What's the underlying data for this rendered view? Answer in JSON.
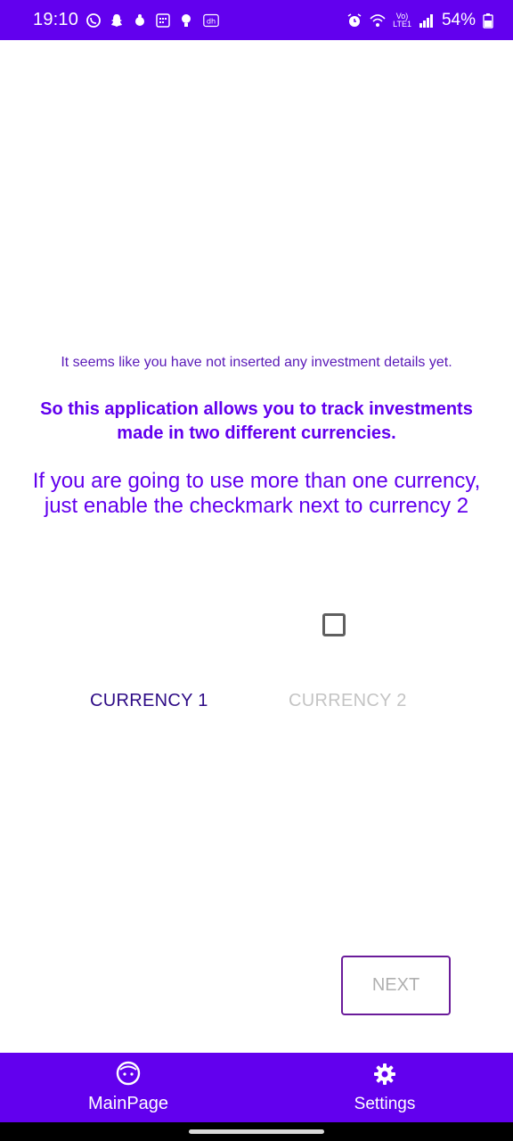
{
  "status_bar": {
    "time": "19:10",
    "left_icons": [
      "whatsapp-icon",
      "snapchat-icon",
      "notification-icon",
      "calendar-icon",
      "bulb-icon",
      "dh-icon"
    ],
    "dh_label": "dh",
    "lte_top": "Vo)",
    "lte_bottom": "LTE1",
    "battery": "54%"
  },
  "messages": {
    "line1": "It seems like you have not inserted any investment details yet.",
    "line2": "So this application allows you to track investments made in two different currencies.",
    "line3": "If you are going to use more than one currency, just enable the checkmark next to currency 2"
  },
  "currency": {
    "currency1_label": "CURRENCY 1",
    "currency2_label": "CURRENCY 2",
    "currency2_enabled": false
  },
  "next_button": {
    "label": "NEXT",
    "enabled": false
  },
  "bottom_nav": {
    "items": [
      {
        "label": "MainPage",
        "icon": "face-icon"
      },
      {
        "label": "Settings",
        "icon": "gear-icon"
      }
    ]
  },
  "colors": {
    "accent": "#6200ee",
    "text_primary": "#2d0a85",
    "disabled": "#c4c4c4"
  }
}
